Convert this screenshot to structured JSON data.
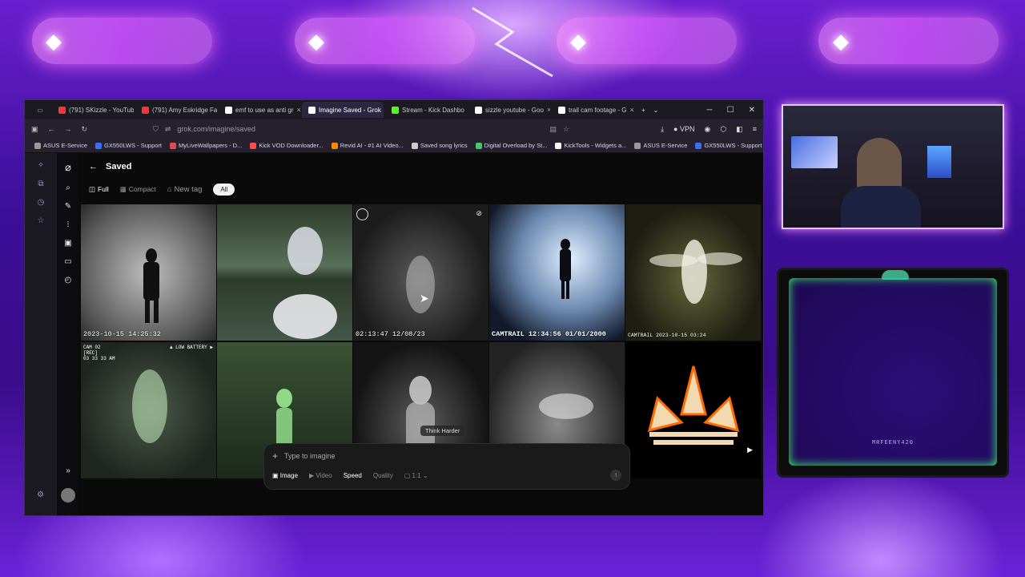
{
  "window": {
    "controls": [
      "─",
      "☐",
      "✕"
    ]
  },
  "tabs": [
    {
      "label": "(791) SKizzle - YouTube",
      "color": "#ff3333"
    },
    {
      "label": "(791) Amy Eskridge Fa",
      "color": "#ff3333"
    },
    {
      "label": "emf to use as anti gr",
      "color": "#ffffff"
    },
    {
      "label": "Imagine Saved - Grok",
      "color": "#ffffff",
      "active": true
    },
    {
      "label": "Stream - Kick Dashbo",
      "color": "#53fc18"
    },
    {
      "label": "sizzle youtube - Goo",
      "color": "#ffffff"
    },
    {
      "label": "trail cam footage - G",
      "color": "#ffffff"
    }
  ],
  "address": {
    "url": "grok.com/imagine/saved",
    "vpn": "VPN"
  },
  "bookmarks": [
    {
      "label": "ASUS E-Service",
      "color": "#999"
    },
    {
      "label": "GX550LWS - Support",
      "color": "#3b6ef5"
    },
    {
      "label": "MyLiveWallpapers - D...",
      "color": "#e04a4a"
    },
    {
      "label": "Kick VOD Downloader...",
      "color": "#ff4d4d"
    },
    {
      "label": "Revid AI - #1 AI Video...",
      "color": "#ff8800"
    },
    {
      "label": "Saved song lyrics",
      "color": "#cccccc"
    },
    {
      "label": "Digital Overload by St...",
      "color": "#44c767"
    },
    {
      "label": "KickTools - Widgets a...",
      "color": "#ffffff"
    },
    {
      "label": "ASUS E-Service",
      "color": "#999"
    },
    {
      "label": "GX550LWS - Support",
      "color": "#3b6ef5"
    }
  ],
  "page": {
    "title": "Saved",
    "filters": {
      "full": "Full",
      "compact": "Compact",
      "new_tag": "New tag",
      "all": "All"
    }
  },
  "tiles": [
    {
      "caption": "2023-10-15 14:25:32",
      "caption_pos": "bottom"
    },
    {
      "caption": "",
      "caption_pos": "none"
    },
    {
      "caption": "02:13:47 12/08/23",
      "caption_pos": "bottom"
    },
    {
      "caption": "CAMTRAIL 12:34:56  01/01/2000",
      "caption_pos": "bottom"
    },
    {
      "caption": "CAMTRAIL 2023-10-15 03:24",
      "caption_pos": "bottom"
    },
    {
      "caption": "CAM 02\n[REC]\n03 33 33 AM",
      "caption_pos": "top",
      "extra": "▲ LOW BATTERY ▶"
    },
    {
      "caption": "",
      "caption_pos": "none"
    },
    {
      "caption": "",
      "caption_pos": "none"
    },
    {
      "caption": "",
      "caption_pos": "none"
    },
    {
      "caption": "",
      "caption_pos": "none"
    }
  ],
  "tooltip": "Think Harder",
  "prompt": {
    "placeholder": "Type to imagine",
    "image": "Image",
    "video": "Video",
    "speed": "Speed",
    "quality": "Quality",
    "ratio": "1:1"
  },
  "overlay": {
    "cam_label": "MRFEENY420"
  }
}
